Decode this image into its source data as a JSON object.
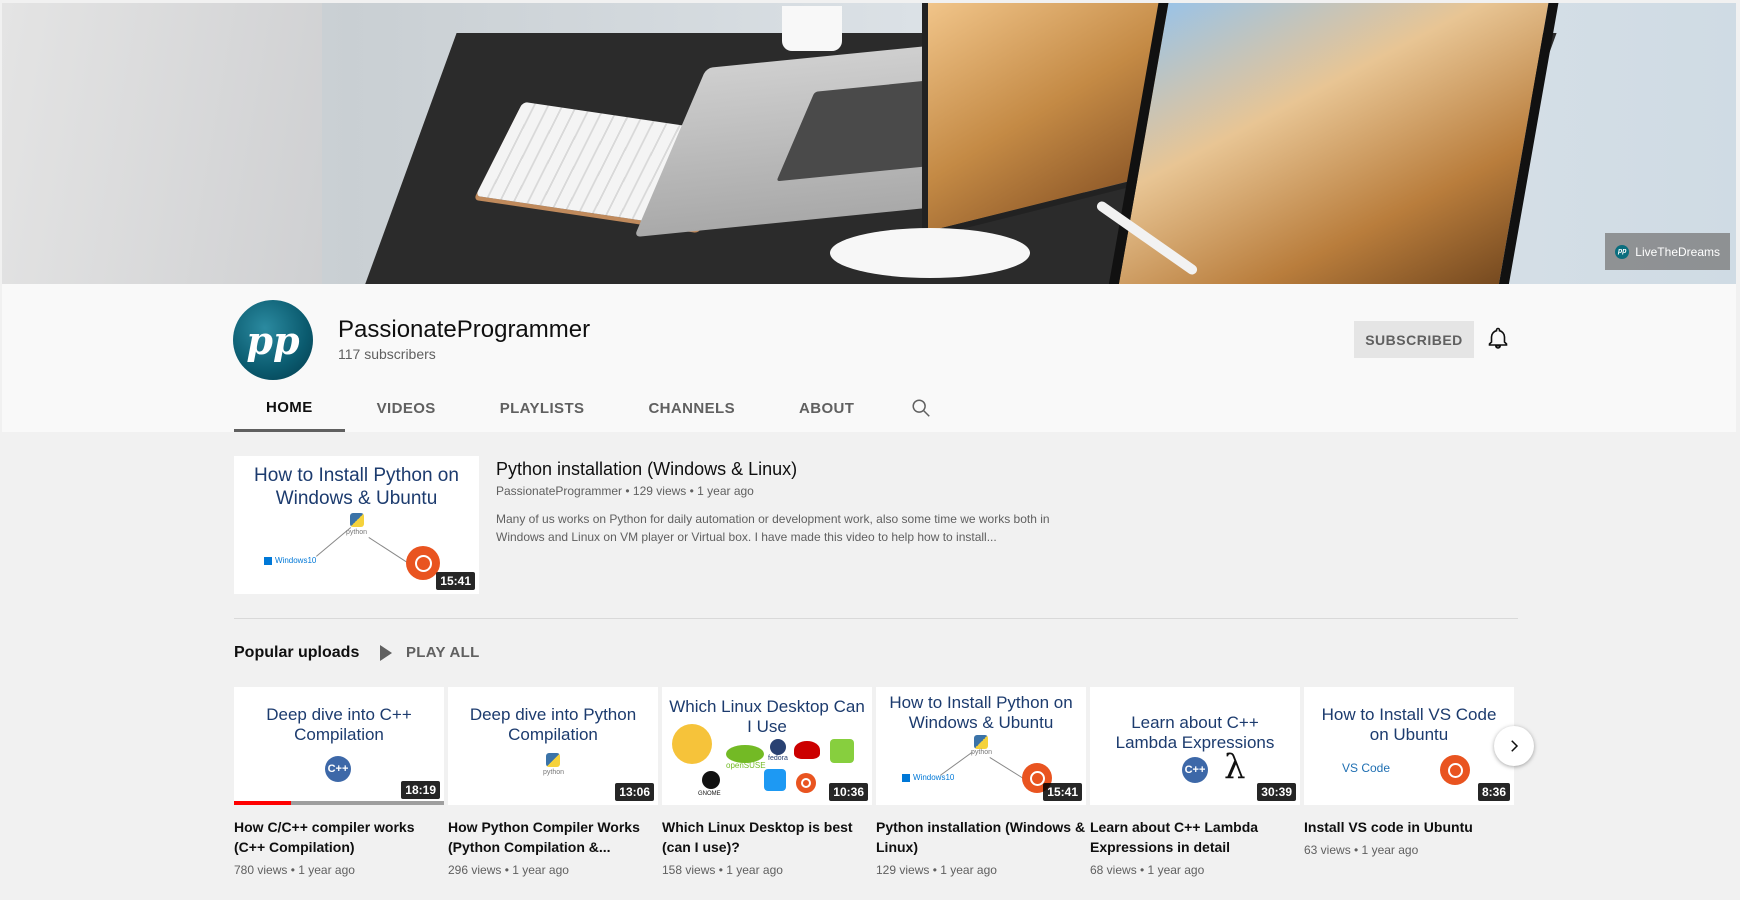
{
  "banner": {
    "link_label": "LiveTheDreams"
  },
  "channel": {
    "avatar_text": "pp",
    "name": "PassionateProgrammer",
    "subscribers": "117 subscribers",
    "subscribe_label": "SUBSCRIBED"
  },
  "tabs": [
    "HOME",
    "VIDEOS",
    "PLAYLISTS",
    "CHANNELS",
    "ABOUT"
  ],
  "featured": {
    "thumb_title": "How to Install Python on Windows & Ubuntu",
    "thumb_python": "python",
    "thumb_windows": "Windows10",
    "duration": "15:41",
    "title": "Python installation (Windows & Linux)",
    "meta": "PassionateProgrammer • 129 views • 1 year ago",
    "description": "Many of us works on Python for daily automation or development work, also some time we works both in Windows and Linux on VM player or Virtual box. I have made this video to help how to install..."
  },
  "shelf": {
    "title": "Popular uploads",
    "play_all": "PLAY ALL",
    "videos": [
      {
        "thumb_title": "Deep dive into C++ Compilation",
        "duration": "18:19",
        "title": "How C/C++ compiler works (C++ Compilation)",
        "meta": "780 views • 1 year ago",
        "watched_fraction": 0.27
      },
      {
        "thumb_title": "Deep dive into Python Compilation",
        "duration": "13:06",
        "title": "How Python Compiler Works (Python Compilation &...",
        "meta": "296 views • 1 year ago"
      },
      {
        "thumb_title": "Which Linux Desktop Can I Use",
        "duration": "10:36",
        "title": "Which Linux Desktop is best (can I use)?",
        "meta": "158 views • 1 year ago",
        "logos": [
          "openSUSE",
          "fedora",
          "GNOME"
        ]
      },
      {
        "thumb_title": "How to Install Python on Windows & Ubuntu",
        "duration": "15:41",
        "title": "Python installation (Windows & Linux)",
        "meta": "129 views • 1 year ago"
      },
      {
        "thumb_title": "Learn about C++ Lambda Expressions",
        "duration": "30:39",
        "title": "Learn about C++ Lambda Expressions in detail",
        "meta": "68 views • 1 year ago"
      },
      {
        "thumb_title": "How to Install VS Code on Ubuntu",
        "duration": "8:36",
        "title": "Install VS code in Ubuntu",
        "meta": "63 views • 1 year ago",
        "logo_vscode": "VS Code"
      }
    ]
  },
  "icons": {
    "bell": "bell-icon",
    "search": "search-icon",
    "next": "chevron-right-icon",
    "play": "play-icon"
  },
  "colors": {
    "accent_red": "#ff0000",
    "thumb_text": "#1c3b6e",
    "ubuntu": "#e95420"
  }
}
